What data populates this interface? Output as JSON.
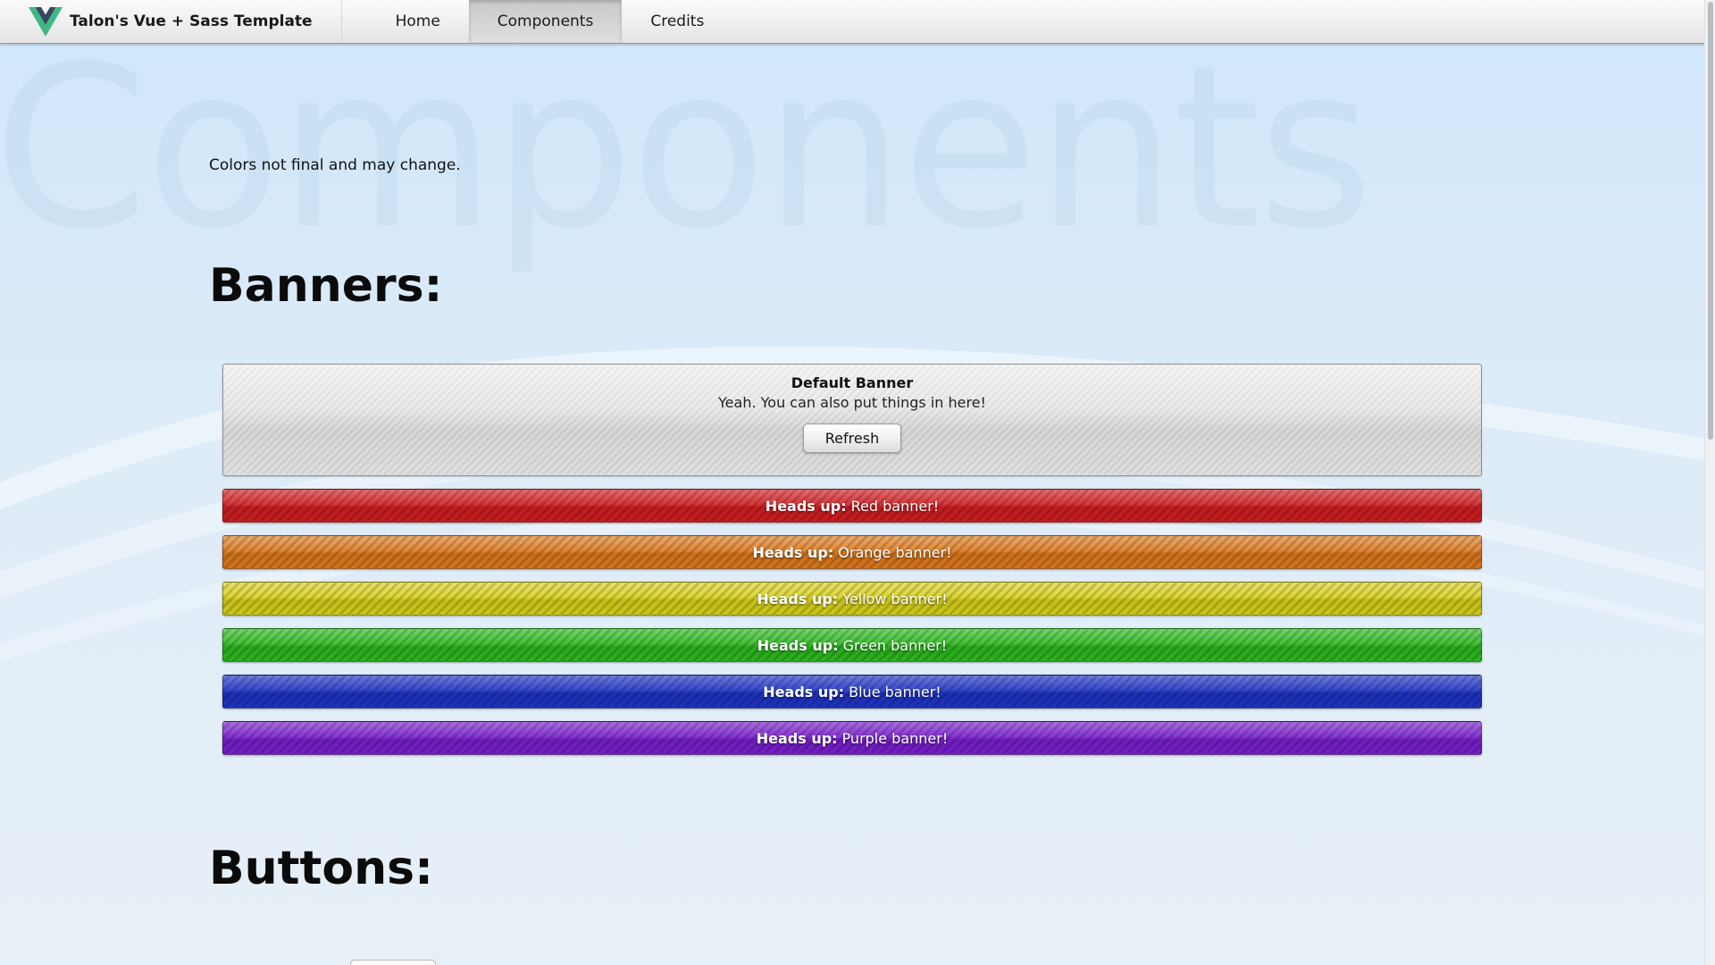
{
  "navbar": {
    "brand_title": "Talon's Vue + Sass Template",
    "links": [
      {
        "label": "Home",
        "active": false
      },
      {
        "label": "Components",
        "active": true
      },
      {
        "label": "Credits",
        "active": false
      }
    ]
  },
  "page": {
    "watermark": "Components",
    "note": "Colors not final and may change."
  },
  "sections": {
    "banners_heading": "Banners:",
    "buttons_heading": "Buttons:"
  },
  "default_banner": {
    "title": "Default Banner",
    "text": "Yeah. You can also put things in here!",
    "button_label": "Refresh"
  },
  "color_banners": [
    {
      "prefix": "Heads up:",
      "text": "Red banner!",
      "color": "#d41f22"
    },
    {
      "prefix": "Heads up:",
      "text": "Orange banner!",
      "color": "#e07b1d"
    },
    {
      "prefix": "Heads up:",
      "text": "Yellow banner!",
      "color": "#d9d21c"
    },
    {
      "prefix": "Heads up:",
      "text": "Green banner!",
      "color": "#2dbb1f"
    },
    {
      "prefix": "Heads up:",
      "text": "Blue banner!",
      "color": "#1f35c9"
    },
    {
      "prefix": "Heads up:",
      "text": "Purple banner!",
      "color": "#7a1fd0"
    }
  ],
  "colors": {
    "vue_green": "#41b883",
    "vue_dark": "#35495e"
  }
}
